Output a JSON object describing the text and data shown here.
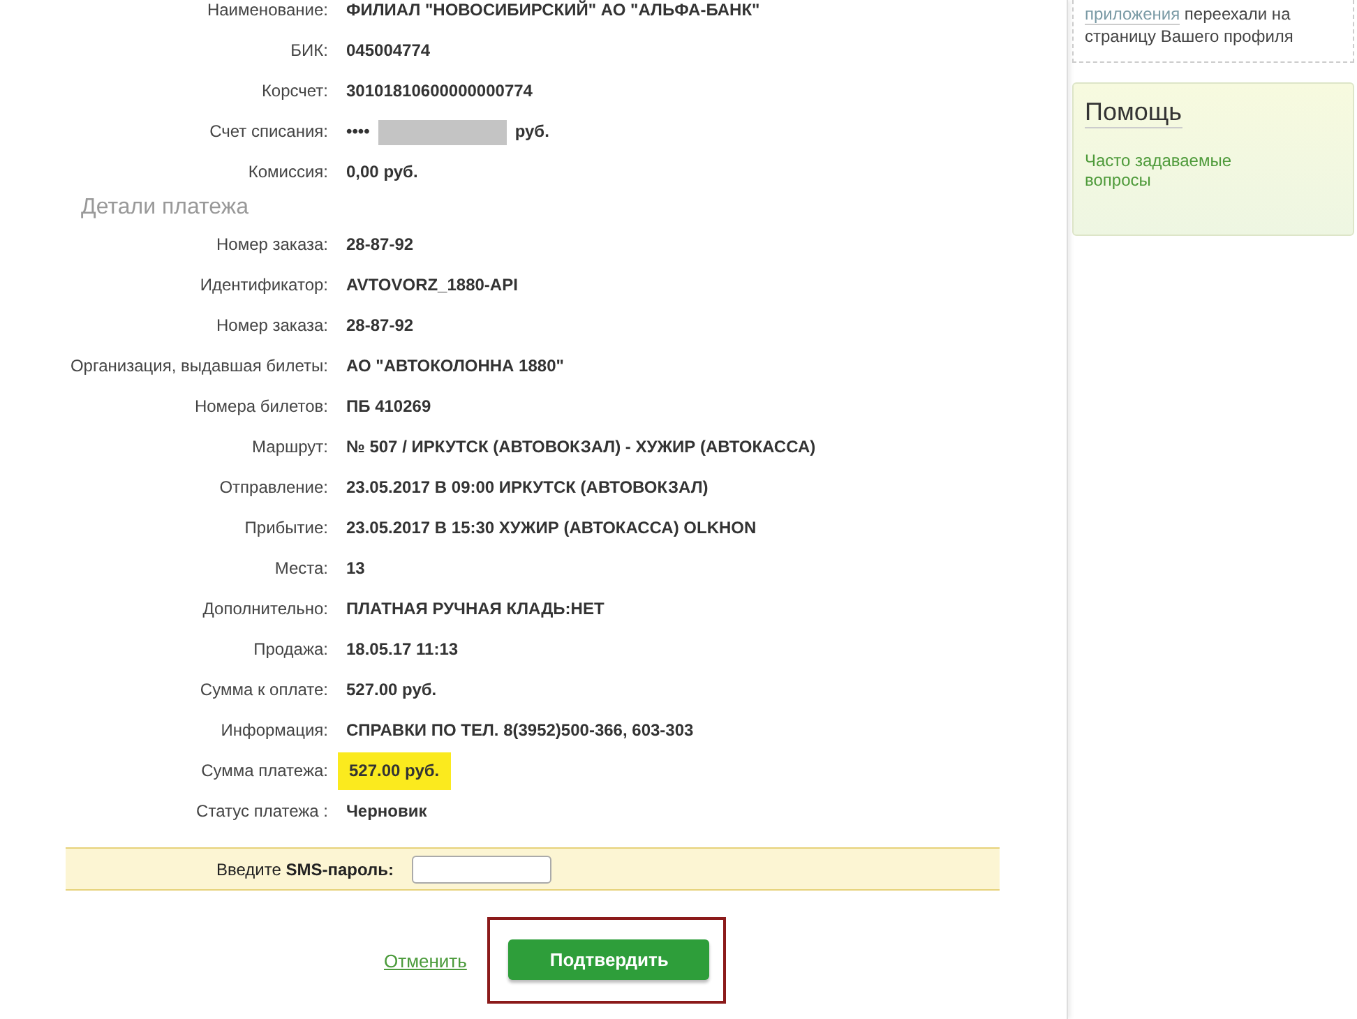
{
  "bank_rows": [
    {
      "kind": "text",
      "label": "Наименование:",
      "value": "ФИЛИАЛ \"НОВОСИБИРСКИЙ\" АО \"АЛЬФА-БАНК\""
    },
    {
      "kind": "text",
      "label": "БИК:",
      "value": "045004774"
    },
    {
      "kind": "text",
      "label": "Корсчет:",
      "value": "30101810600000000774"
    },
    {
      "kind": "masked",
      "label": "Счет списания:",
      "prefix": "••••",
      "value": "руб."
    },
    {
      "kind": "text",
      "label": "Комиссия:",
      "value": "0,00 руб."
    }
  ],
  "details_heading": "Детали платежа",
  "detail_rows": [
    {
      "kind": "text",
      "label": "Номер заказа:",
      "value": "28-87-92"
    },
    {
      "kind": "text",
      "label": "Идентификатор:",
      "value": "AVTOVORZ_1880-API"
    },
    {
      "kind": "text",
      "label": "Номер заказа:",
      "value": "28-87-92"
    },
    {
      "kind": "text",
      "label": "Организация, выдавшая билеты:",
      "value": "АО \"АВТОКОЛОННА 1880\""
    },
    {
      "kind": "text",
      "label": "Номера билетов:",
      "value": "ПБ 410269"
    },
    {
      "kind": "text",
      "label": "Маршрут:",
      "value": "№ 507 / ИРКУТСК (АВТОВОКЗАЛ) - ХУЖИР (АВТОКАССА)"
    },
    {
      "kind": "text",
      "label": "Отправление:",
      "value": "23.05.2017 В 09:00 ИРКУТСК (АВТОВОКЗАЛ)"
    },
    {
      "kind": "text",
      "label": "Прибытие:",
      "value": "23.05.2017 В 15:30 ХУЖИР (АВТОКАССА) OLKHON"
    },
    {
      "kind": "text",
      "label": "Места:",
      "value": "13"
    },
    {
      "kind": "text",
      "label": "Дополнительно:",
      "value": "ПЛАТНАЯ РУЧНАЯ КЛАДЬ:НЕТ"
    },
    {
      "kind": "text",
      "label": "Продажа:",
      "value": "18.05.17 11:13"
    },
    {
      "kind": "text",
      "label": "Сумма к оплате:",
      "value": "527.00 руб."
    },
    {
      "kind": "text",
      "label": "Информация:",
      "value": "СПРАВКИ ПО ТЕЛ. 8(3952)500-366, 603-303"
    },
    {
      "kind": "highlight",
      "label": "Сумма платежа:",
      "value": "527.00 руб."
    },
    {
      "kind": "text",
      "label": "Статус платежа :",
      "value": "Черновик"
    }
  ],
  "sms": {
    "label": "Введите **SMS-пароль:**"
  },
  "actions": {
    "cancel": "Отменить",
    "confirm": "Подтвердить"
  },
  "sidebar": {
    "notice_link": "приложения",
    "notice_text": "переехали на страницу Вашего профиля",
    "help_title": "Помощь",
    "help_link": "Часто задаваемые вопросы"
  }
}
